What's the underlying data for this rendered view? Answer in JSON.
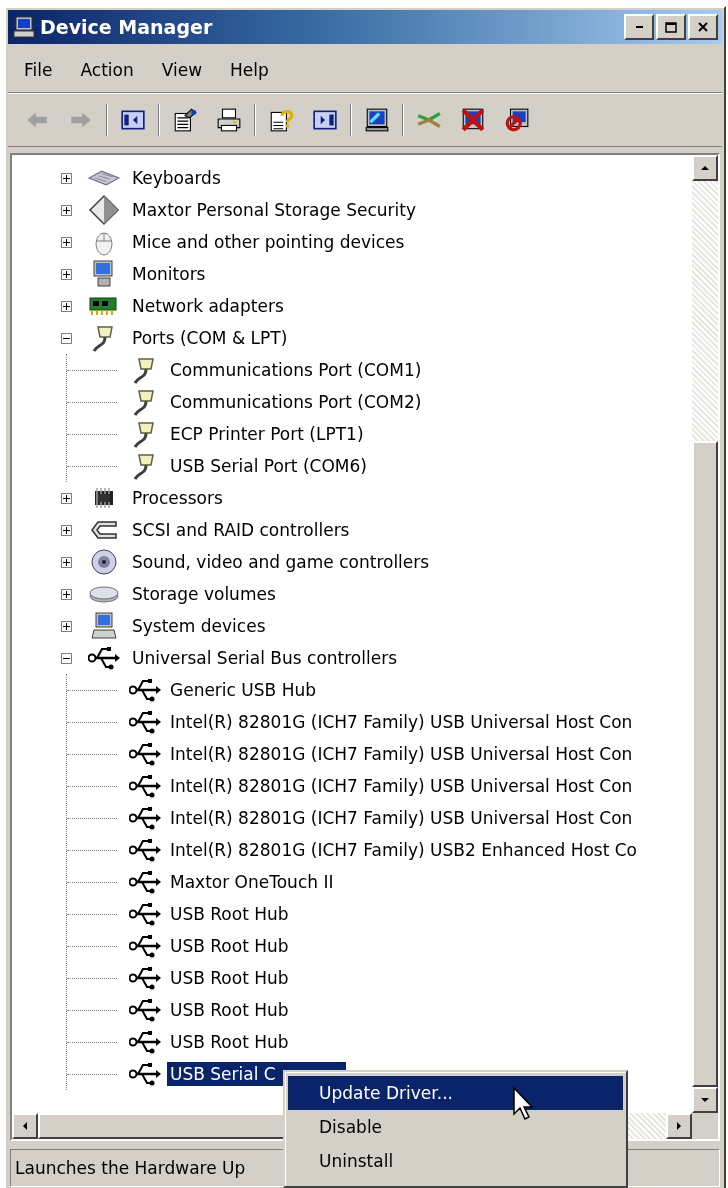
{
  "window": {
    "title": "Device Manager"
  },
  "menu": [
    "File",
    "Action",
    "View",
    "Help"
  ],
  "toolbar": [
    {
      "kind": "back",
      "disabled": true
    },
    {
      "kind": "forward",
      "disabled": true
    },
    {
      "kind": "separator"
    },
    {
      "kind": "tree-pane"
    },
    {
      "kind": "separator"
    },
    {
      "kind": "properties"
    },
    {
      "kind": "print"
    },
    {
      "kind": "separator"
    },
    {
      "kind": "help"
    },
    {
      "kind": "action-pane"
    },
    {
      "kind": "separator"
    },
    {
      "kind": "scan"
    },
    {
      "kind": "separator"
    },
    {
      "kind": "update"
    },
    {
      "kind": "uninstall"
    },
    {
      "kind": "disable"
    }
  ],
  "tree": [
    {
      "label": "Keyboards",
      "kind": "keyboard",
      "expanded": false,
      "selected": false
    },
    {
      "label": "Maxtor Personal Storage Security",
      "kind": "diamond",
      "expanded": false,
      "selected": false
    },
    {
      "label": "Mice and other pointing devices",
      "kind": "mouse",
      "expanded": false,
      "selected": false
    },
    {
      "label": "Monitors",
      "kind": "monitor",
      "expanded": false,
      "selected": false
    },
    {
      "label": "Network adapters",
      "kind": "network",
      "expanded": false,
      "selected": false
    },
    {
      "label": "Ports (COM & LPT)",
      "kind": "port",
      "expanded": true,
      "selected": false,
      "children": [
        {
          "label": "Communications Port (COM1)",
          "kind": "port",
          "selected": false
        },
        {
          "label": "Communications Port (COM2)",
          "kind": "port",
          "selected": false
        },
        {
          "label": "ECP Printer Port (LPT1)",
          "kind": "port",
          "selected": false
        },
        {
          "label": "USB Serial Port (COM6)",
          "kind": "port",
          "selected": false
        }
      ]
    },
    {
      "label": "Processors",
      "kind": "processor",
      "expanded": false,
      "selected": false
    },
    {
      "label": "SCSI and RAID controllers",
      "kind": "scsi",
      "expanded": false,
      "selected": false
    },
    {
      "label": "Sound, video and game controllers",
      "kind": "sound",
      "expanded": false,
      "selected": false
    },
    {
      "label": "Storage volumes",
      "kind": "volume",
      "expanded": false,
      "selected": false
    },
    {
      "label": "System devices",
      "kind": "system",
      "expanded": false,
      "selected": false
    },
    {
      "label": "Universal Serial Bus controllers",
      "kind": "usb",
      "expanded": true,
      "selected": false,
      "children": [
        {
          "label": "Generic USB Hub",
          "kind": "usb",
          "selected": false
        },
        {
          "label": "Intel(R) 82801G (ICH7 Family) USB Universal Host Con",
          "kind": "usb",
          "selected": false
        },
        {
          "label": "Intel(R) 82801G (ICH7 Family) USB Universal Host Con",
          "kind": "usb",
          "selected": false
        },
        {
          "label": "Intel(R) 82801G (ICH7 Family) USB Universal Host Con",
          "kind": "usb",
          "selected": false
        },
        {
          "label": "Intel(R) 82801G (ICH7 Family) USB Universal Host Con",
          "kind": "usb",
          "selected": false
        },
        {
          "label": "Intel(R) 82801G (ICH7 Family) USB2 Enhanced Host Co",
          "kind": "usb",
          "selected": false
        },
        {
          "label": "Maxtor OneTouch II",
          "kind": "usb",
          "selected": false
        },
        {
          "label": "USB Root Hub",
          "kind": "usb",
          "selected": false
        },
        {
          "label": "USB Root Hub",
          "kind": "usb",
          "selected": false
        },
        {
          "label": "USB Root Hub",
          "kind": "usb",
          "selected": false
        },
        {
          "label": "USB Root Hub",
          "kind": "usb",
          "selected": false
        },
        {
          "label": "USB Root Hub",
          "kind": "usb",
          "selected": false
        },
        {
          "label": "USB Serial C",
          "kind": "usb",
          "selected": true
        }
      ]
    }
  ],
  "context_menu": [
    {
      "label": "Update Driver...",
      "selected": true
    },
    {
      "label": "Disable",
      "selected": false
    },
    {
      "label": "Uninstall",
      "selected": false
    }
  ],
  "status_bar": {
    "text": "Launches the Hardware Up"
  }
}
